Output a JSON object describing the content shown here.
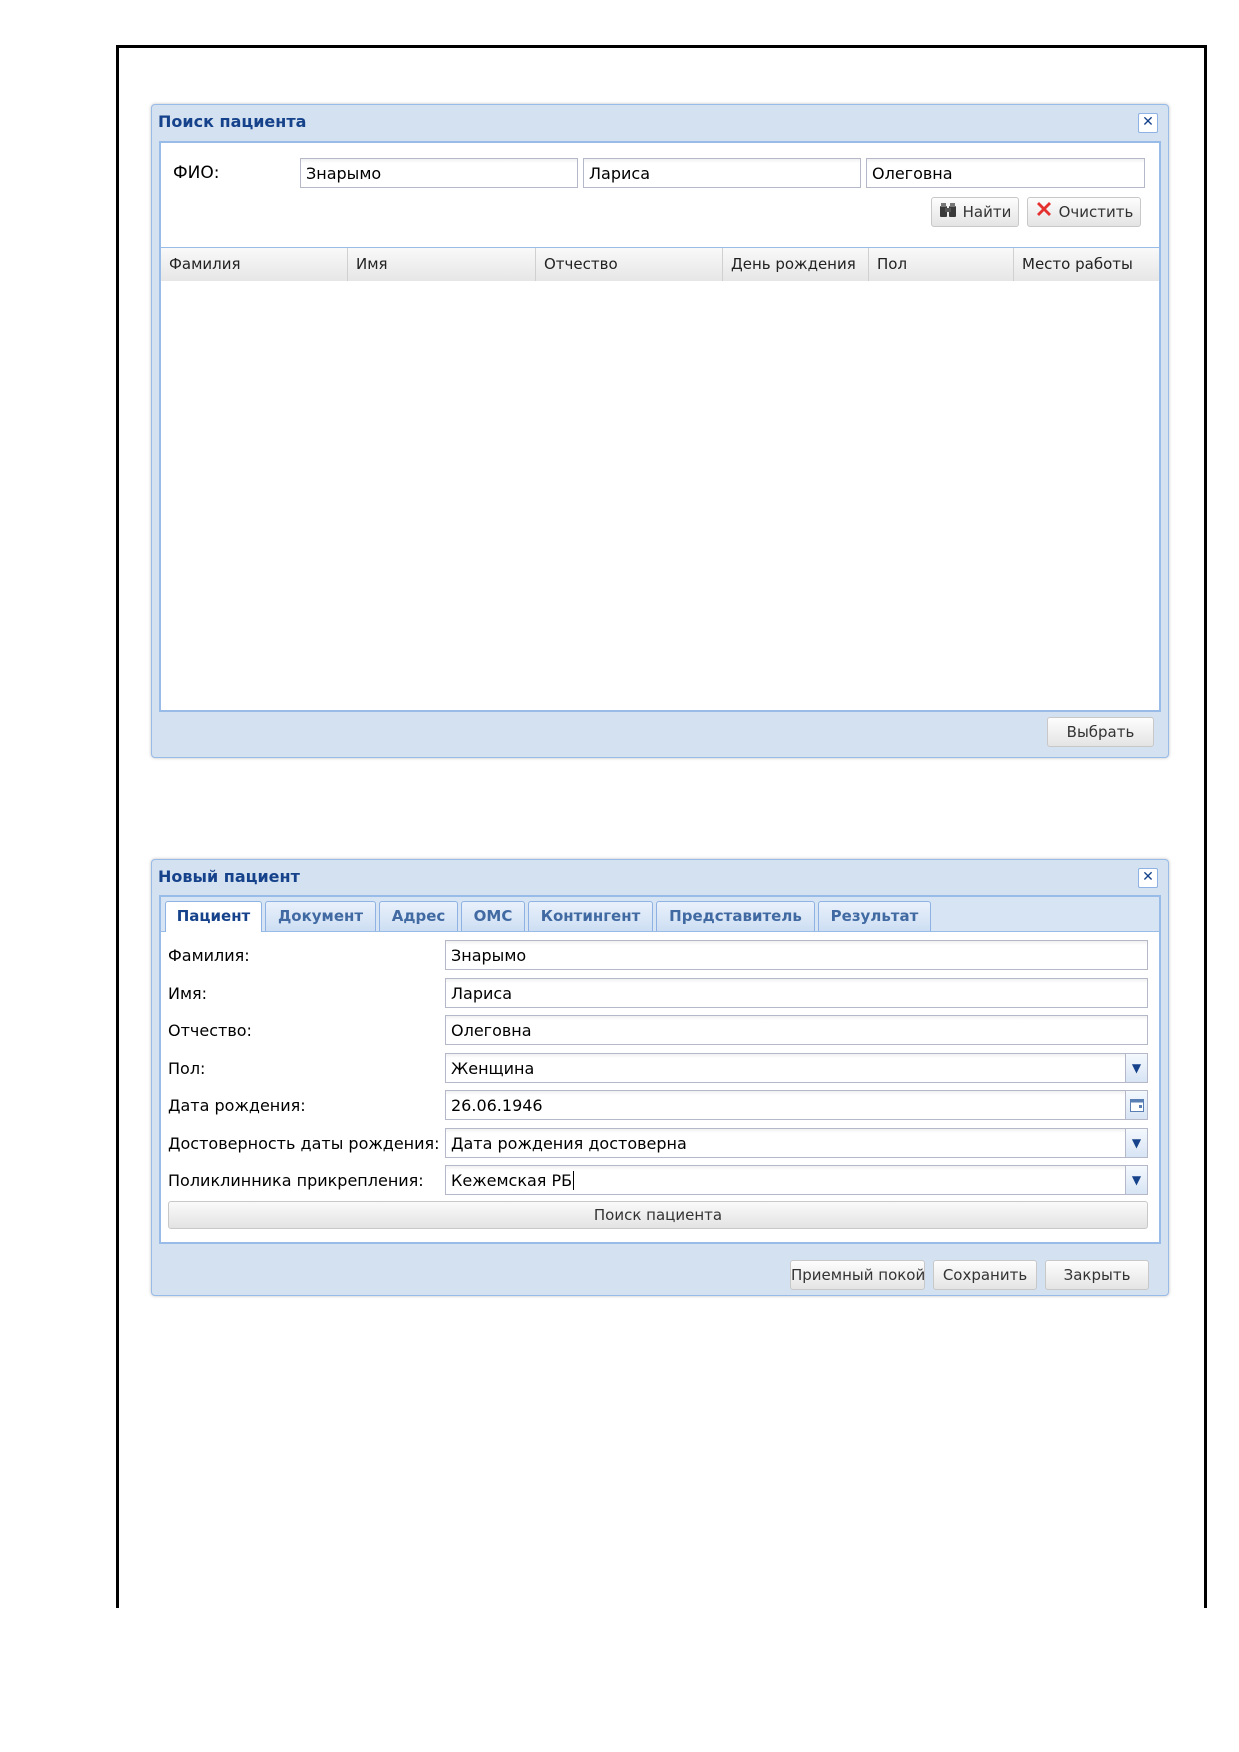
{
  "search_window": {
    "title": "Поиск пациента",
    "fio_label": "ФИО:",
    "surname_value": "Знарымо",
    "name_value": "Лариса",
    "patronymic_value": "Олеговна",
    "find_button": "Найти",
    "clear_button": "Очистить",
    "columns": [
      "Фамилия",
      "Имя",
      "Отчество",
      "День рождения",
      "Пол",
      "Место работы"
    ],
    "select_button": "Выбрать"
  },
  "patient_window": {
    "title": "Новый пациент",
    "tabs": [
      "Пациент",
      "Документ",
      "Адрес",
      "ОМС",
      "Контингент",
      "Представитель",
      "Результат"
    ],
    "fields": {
      "surname": {
        "label": "Фамилия:",
        "value": "Знарымо"
      },
      "name": {
        "label": "Имя:",
        "value": "Лариса"
      },
      "patronymic": {
        "label": "Отчество:",
        "value": "Олеговна"
      },
      "sex": {
        "label": "Пол:",
        "value": "Женщина"
      },
      "birth_date": {
        "label": "Дата рождения:",
        "value": "26.06.1946"
      },
      "birth_date_reliability": {
        "label": "Достоверность даты рождения:",
        "value": "Дата рождения достоверна"
      },
      "clinic": {
        "label": "Поликлинника прикрепления:",
        "value": "Кежемская РБ"
      }
    },
    "search_patient_button": "Поиск пациента",
    "admission_button": "Приемный покой",
    "save_button": "Сохранить",
    "close_button": "Закрыть"
  },
  "icons": {
    "find": "binoculars-icon",
    "clear": "red-x-icon",
    "close": "close-icon",
    "combo": "chevron-down-icon",
    "calendar": "calendar-icon"
  },
  "colors": {
    "title": "#15428b",
    "window_bg": "#d3e1f1",
    "border": "#99bbe8",
    "clear_icon": "#e53030"
  }
}
